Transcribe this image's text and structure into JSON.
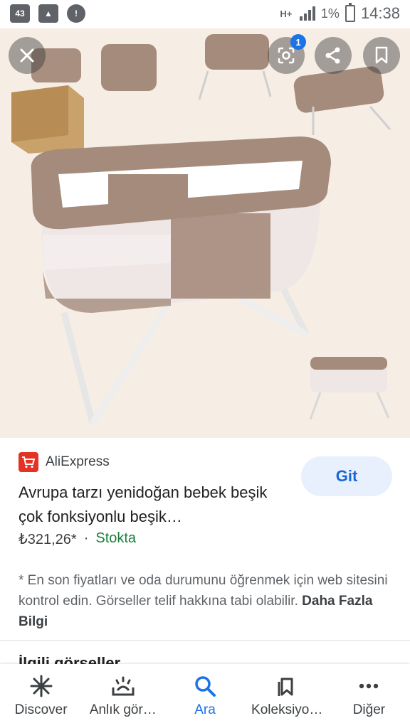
{
  "status_bar": {
    "notif_badge": "43",
    "network_label": "H+",
    "battery": "1%",
    "time": "14:38"
  },
  "image_overlay": {
    "lens_badge_count": "1",
    "icons": [
      "close-icon",
      "lens-icon",
      "share-icon",
      "bookmark-icon"
    ]
  },
  "result": {
    "source": "AliExpress",
    "title": "Avrupa tarzı yenidoğan bebek beşik çok fonksiyonlu beşik…",
    "price": "₺321,26*",
    "separator": "·",
    "stock": "Stokta",
    "visit_label": "Git"
  },
  "notice": {
    "text": "* En son fiyatları ve oda durumunu öğrenmek için web sitesini kontrol edin. Görseller telif hakkına tabi olabilir.",
    "link": "Daha Fazla Bilgi"
  },
  "related": {
    "heading": "İlgili görseller"
  },
  "bottom_nav": [
    {
      "label": "Discover",
      "icon": "asterisk-icon"
    },
    {
      "label": "Anlık gör…",
      "icon": "updates-icon"
    },
    {
      "label": "Ara",
      "icon": "search-icon"
    },
    {
      "label": "Koleksiyo…",
      "icon": "collections-icon"
    },
    {
      "label": "Diğer",
      "icon": "more-icon"
    }
  ],
  "colors": {
    "accent": "#1a73e8",
    "stock_green": "#188038",
    "image_bg": "#f6ede4",
    "crib_fabric": "#a58b7c"
  }
}
